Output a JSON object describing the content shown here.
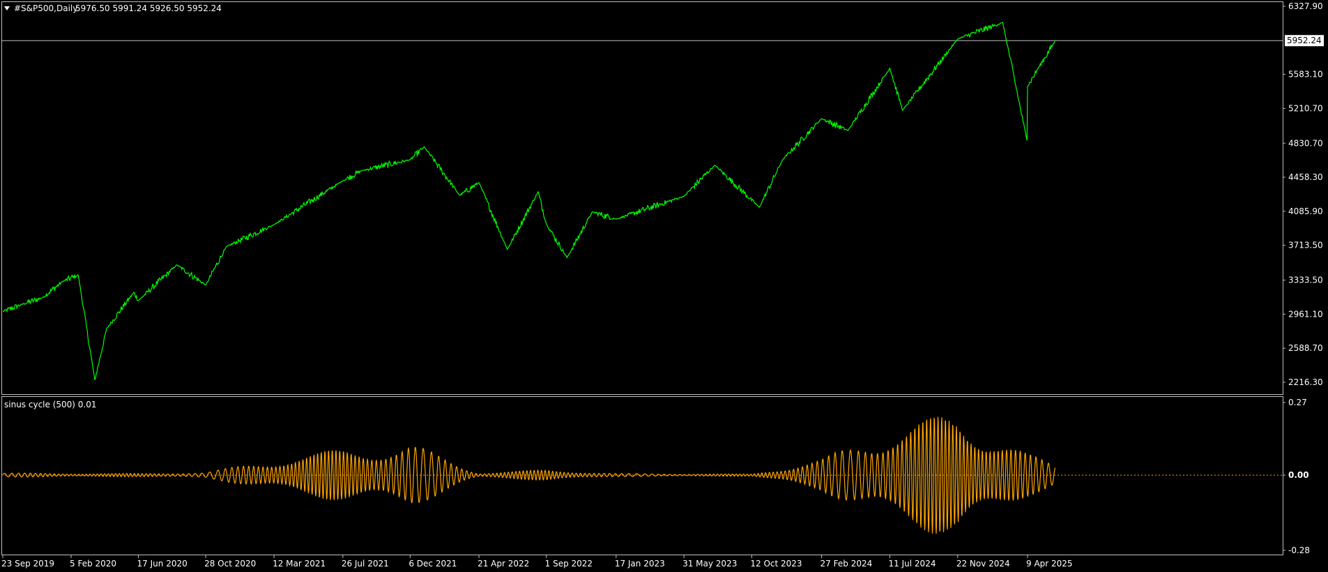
{
  "header": {
    "symbol": "#S&P500,Daily",
    "ohlc": "5976.50 5991.24 5926.50 5952.24"
  },
  "indicator": {
    "label": "sinus cycle (500) 0.01"
  },
  "colors": {
    "background": "#000000",
    "price_line": "#00ff00",
    "indicator_line": "#ffa500",
    "axis": "#c0c0c0"
  },
  "chart_data": [
    {
      "type": "line",
      "title": "#S&P500,Daily",
      "series": [
        {
          "name": "#S&P500,Daily",
          "x": [
            "23 Sep 2019",
            "1 Nov 2019",
            "10 Dec 2019",
            "20 Jan 2020",
            "19 Feb 2020",
            "23 Mar 2020",
            "15 Apr 2020",
            "8 Jun 2020",
            "17 Jun 2020",
            "1 Sep 2020",
            "28 Oct 2020",
            "8 Dec 2020",
            "12 Mar 2021",
            "26 Jul 2021",
            "1 Sep 2021",
            "6 Dec 2021",
            "3 Jan 2022",
            "14 Mar 2022",
            "21 Apr 2022",
            "16 Jun 2022",
            "16 Aug 2022",
            "1 Sep 2022",
            "12 Oct 2022",
            "1 Dec 2022",
            "17 Jan 2023",
            "31 May 2023",
            "31 Jul 2023",
            "27 Oct 2023",
            "12 Dec 2023",
            "27 Feb 2024",
            "19 Apr 2024",
            "11 Jul 2024",
            "5 Aug 2024",
            "22 Nov 2024",
            "19 Feb 2025",
            "8 Apr 2025",
            "9 Apr 2025",
            "30 Apr 2025",
            "3 Jun 2025"
          ],
          "values": [
            2990,
            3070,
            3140,
            3320,
            3390,
            2240,
            2800,
            3200,
            3110,
            3500,
            3280,
            3700,
            3940,
            4420,
            4530,
            4650,
            4790,
            4260,
            4400,
            3670,
            4300,
            3950,
            3580,
            4080,
            4000,
            4250,
            4590,
            4130,
            4650,
            5100,
            4970,
            5650,
            5190,
            5970,
            6150,
            4860,
            5450,
            5650,
            5952
          ]
        }
      ],
      "ylim": [
        2216.3,
        6327.9
      ],
      "yticks": [
        "6327.90",
        "5952.24",
        "5583.10",
        "5210.70",
        "4830.70",
        "4458.30",
        "4085.90",
        "3713.50",
        "3333.50",
        "2961.10",
        "2588.70",
        "2216.30"
      ],
      "last_value_label": "5952.24",
      "grid": false
    },
    {
      "type": "line",
      "title": "sinus cycle (500) 0.01",
      "series": [
        {
          "name": "sinus cycle (500) 0.01",
          "envelope_dates": [
            "23 Sep 2019",
            "5 Feb 2020",
            "17 Jun 2020",
            "28 Oct 2020",
            "12 Mar 2021",
            "26 Jul 2021",
            "6 Dec 2021",
            "1 Jan 2022",
            "21 Apr 2022",
            "1 Sep 2022",
            "17 Jan 2023",
            "31 May 2023",
            "12 Oct 2023",
            "27 Feb 2024",
            "11 Jul 2024",
            "22 Nov 2024",
            "9 Apr 2025",
            "3 Jun 2025"
          ],
          "envelope_amplitude": [
            0.008,
            0.006,
            0.006,
            0.01,
            0.06,
            0.1,
            0.12,
            0.1,
            0.008,
            0.02,
            0.006,
            0.004,
            0.004,
            0.06,
            0.18,
            0.24,
            0.08,
            0.04
          ]
        }
      ],
      "reference_line": 0.0,
      "ylim": [
        -0.28,
        0.27
      ],
      "yticks": [
        "0.27",
        "0.00",
        "-0.28"
      ]
    }
  ],
  "x_axis": {
    "labels": [
      "23 Sep 2019",
      "5 Feb 2020",
      "17 Jun 2020",
      "28 Oct 2020",
      "12 Mar 2021",
      "26 Jul 2021",
      "6 Dec 2021",
      "21 Apr 2022",
      "1 Sep 2022",
      "17 Jan 2023",
      "31 May 2023",
      "12 Oct 2023",
      "27 Feb 2024",
      "11 Jul 2024",
      "22 Nov 2024",
      "9 Apr 2025"
    ]
  }
}
